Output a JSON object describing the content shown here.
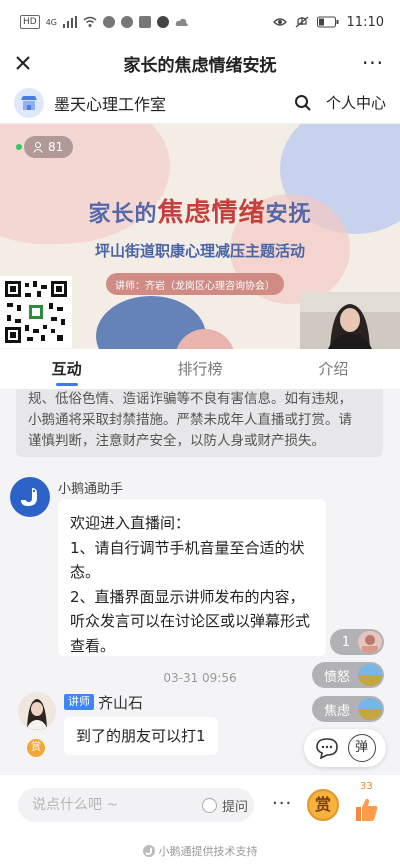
{
  "status_bar": {
    "network_badge": "HD",
    "signal_label": "4G",
    "time": "11:10"
  },
  "window": {
    "title": "家长的焦虑情绪安抚",
    "more_label": "···"
  },
  "studio": {
    "name": "墨天心理工作室",
    "profile_link": "个人中心"
  },
  "video": {
    "viewer_count": "81",
    "banner_title_pre": "家长的",
    "banner_title_hl": "焦虑情绪",
    "banner_title_post": "安抚",
    "banner_subtitle": "坪山街道职康心理减压主题活动",
    "speaker_line": "讲师：齐岩（龙岗区心理咨询协会）"
  },
  "tabs": [
    {
      "label": "互动",
      "active": true
    },
    {
      "label": "排行榜",
      "active": false
    },
    {
      "label": "介绍",
      "active": false
    }
  ],
  "chat": {
    "notice_lines": [
      "规、低俗色情、造谣诈骗等不良有害信息。如有违规，",
      "小鹅通将采取封禁措施。严禁未成年人直播或打赏。请",
      "谨慎判断，注意财产安全，以防人身或财产损失。"
    ],
    "bot_name": "小鹅通助手",
    "bot_message_lines": [
      "欢迎进入直播间：",
      "1、请自行调节手机音量至合适的状",
      "态。",
      "2、直播界面显示讲师发布的内容，",
      "听众发言可以在讨论区或以弹幕形式",
      "查看。"
    ],
    "timestamp": "03-31 09:56",
    "teacher_role": "讲师",
    "teacher_name": "齐山石",
    "teacher_message": "到了的朋友可以打1",
    "reward_label": "赏",
    "reactions": [
      {
        "text": "1"
      },
      {
        "text": "愤怒"
      },
      {
        "text": "焦虑"
      }
    ],
    "danmu_label": "弹"
  },
  "input_bar": {
    "placeholder": "说点什么吧 ~",
    "question_label": "提问",
    "more_label": "···",
    "reward_label": "赏",
    "like_count": "33"
  },
  "footer": {
    "credit": "小鹅通提供技术支持"
  },
  "colors": {
    "accent_blue": "#3a7bf0",
    "banner_title_blue": "#5468a8",
    "banner_highlight_red": "#c2413d",
    "role_badge": "#3e86f2",
    "reward_orange": "#f5b23d"
  }
}
